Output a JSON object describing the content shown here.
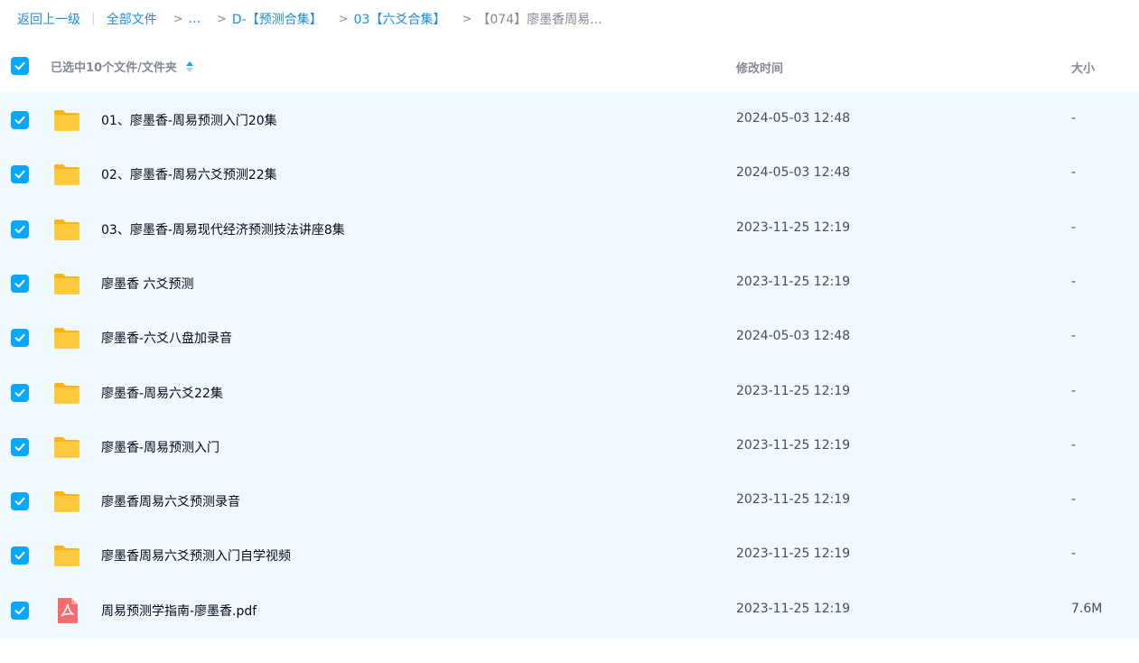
{
  "breadcrumb": {
    "back": "返回上一级",
    "divider": "|",
    "items": [
      "全部文件",
      "...",
      "D-【预测合集】",
      "03【六爻合集】",
      "【074】廖墨香周易..."
    ],
    "separator": ">"
  },
  "header": {
    "selection_label": "已选中10个文件/文件夹",
    "time_label": "修改时间",
    "size_label": "大小"
  },
  "colors": {
    "accent": "#06a7ff",
    "list_bg": "#eff9fe",
    "folder": "#ffc940",
    "pdf": "#f56c6c"
  },
  "files": [
    {
      "name": "01、廖墨香-周易预测入门20集",
      "time": "2024-05-03 12:48",
      "size": "-",
      "type": "folder-icon",
      "checked": true
    },
    {
      "name": "02、廖墨香-周易六爻预测22集",
      "time": "2024-05-03 12:48",
      "size": "-",
      "type": "folder-icon",
      "checked": true
    },
    {
      "name": "03、廖墨香-周易现代经济预测技法讲座8集",
      "time": "2023-11-25 12:19",
      "size": "-",
      "type": "folder-icon",
      "checked": true
    },
    {
      "name": "廖墨香 六爻预测",
      "time": "2023-11-25 12:19",
      "size": "-",
      "type": "folder-icon",
      "checked": true
    },
    {
      "name": "廖墨香-六爻八盘加录音",
      "time": "2024-05-03 12:48",
      "size": "-",
      "type": "folder-icon",
      "checked": true
    },
    {
      "name": "廖墨香-周易六爻22集",
      "time": "2023-11-25 12:19",
      "size": "-",
      "type": "folder-icon",
      "checked": true
    },
    {
      "name": "廖墨香-周易预测入门",
      "time": "2023-11-25 12:19",
      "size": "-",
      "type": "folder-icon",
      "checked": true
    },
    {
      "name": "廖墨香周易六爻预测录音",
      "time": "2023-11-25 12:19",
      "size": "-",
      "type": "folder-icon",
      "checked": true
    },
    {
      "name": "廖墨香周易六爻预测入门自学视频",
      "time": "2023-11-25 12:19",
      "size": "-",
      "type": "folder-icon",
      "checked": true
    },
    {
      "name": "周易预测学指南-廖墨香.pdf",
      "time": "2023-11-25 12:19",
      "size": "7.6M",
      "type": "pdf-icon",
      "checked": true
    }
  ]
}
